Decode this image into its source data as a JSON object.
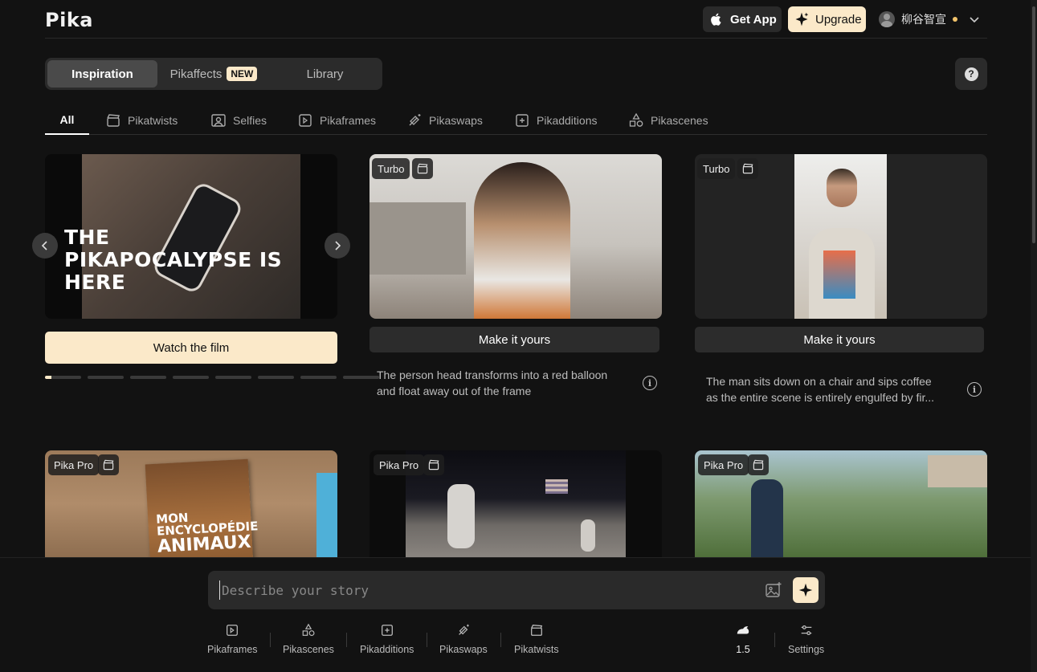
{
  "header": {
    "logo": "Pika",
    "get_app": "Get App",
    "upgrade": "Upgrade",
    "user_name": "柳谷智宣"
  },
  "top_tabs": {
    "inspiration": "Inspiration",
    "pikaffects": "Pikaffects",
    "new_badge": "NEW",
    "library": "Library"
  },
  "help": "?",
  "categories": [
    "All",
    "Pikatwists",
    "Selfies",
    "Pikaframes",
    "Pikaswaps",
    "Pikadditions",
    "Pikascenes"
  ],
  "hero": {
    "line1": "THE",
    "line2": "PIKAPOCALYPSE IS",
    "line3": "HERE",
    "watch": "Watch the film",
    "pages": 8,
    "current_page": 1
  },
  "cards": [
    {
      "tag": "Turbo",
      "button": "Make it yours",
      "desc1": "The person head transforms into a red balloon",
      "desc2": "and float away out of the frame"
    },
    {
      "tag": "Turbo",
      "button": "Make it yours",
      "desc1": "The man sits down on a chair and sips coffee",
      "desc2": "as the entire scene is entirely engulfed by fir..."
    },
    {
      "tag": "Pika Pro",
      "book1": "MON",
      "book2": "ENCYCLOPÉDIE",
      "book3": "ANIMAUX"
    },
    {
      "tag": "Pika Pro"
    },
    {
      "tag": "Pika Pro"
    }
  ],
  "prompt": {
    "placeholder": "Describe your story"
  },
  "tools": [
    "Pikaframes",
    "Pikascenes",
    "Pikadditions",
    "Pikaswaps",
    "Pikatwists"
  ],
  "model": "1.5",
  "settings": "Settings",
  "colors": {
    "accent": "#fbe9c9",
    "background": "#121212",
    "status_dot": "#f3c46b"
  }
}
